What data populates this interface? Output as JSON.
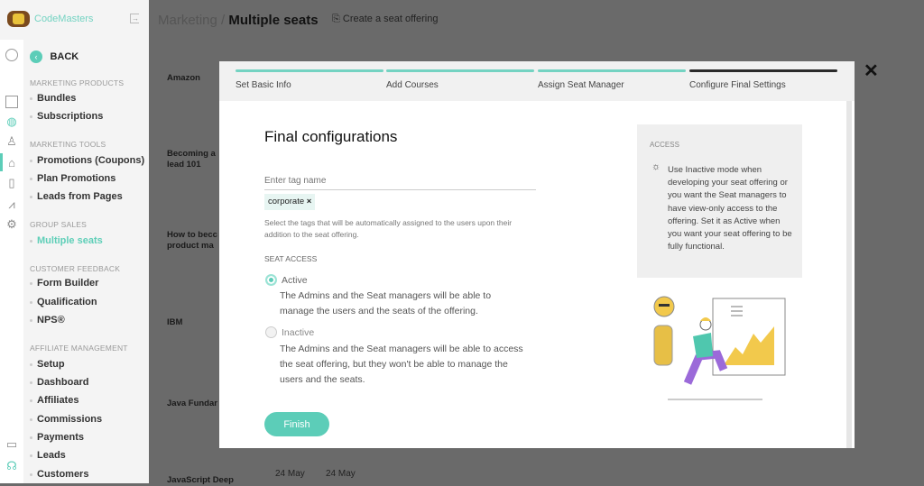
{
  "app": {
    "name": "CodeMasters"
  },
  "header": {
    "breadcrumb_parent": "Marketing",
    "breadcrumb_sep": " / ",
    "title": "Multiple seats",
    "action": "Create a seat offering"
  },
  "sidebar": {
    "back": "BACK",
    "sections": [
      {
        "title": "MARKETING PRODUCTS",
        "items": [
          "Bundles",
          "Subscriptions"
        ]
      },
      {
        "title": "MARKETING TOOLS",
        "items": [
          "Promotions (Coupons)",
          "Plan Promotions",
          "Leads from Pages"
        ]
      },
      {
        "title": "GROUP SALES",
        "items": [
          "Multiple seats"
        ]
      },
      {
        "title": "CUSTOMER FEEDBACK",
        "items": [
          "Form Builder",
          "Qualification",
          "NPS®"
        ]
      },
      {
        "title": "AFFILIATE MANAGEMENT",
        "items": [
          "Setup",
          "Dashboard",
          "Affiliates",
          "Commissions",
          "Payments",
          "Leads",
          "Customers"
        ]
      }
    ],
    "active_item": "Multiple seats"
  },
  "background_list": {
    "rows": [
      "Amazon",
      "Becoming a\nlead 101",
      "How to becc\nproduct ma",
      "IBM",
      "Java Fundar",
      "JavaScript Deep"
    ],
    "dates": [
      "24 May",
      "24 May"
    ]
  },
  "modal": {
    "steps": [
      {
        "label": "Set Basic Info",
        "done": true
      },
      {
        "label": "Add Courses",
        "done": true
      },
      {
        "label": "Assign Seat Manager",
        "done": true
      },
      {
        "label": "Configure Final Settings",
        "current": true
      }
    ],
    "title": "Final configurations",
    "tag_input": {
      "placeholder": "Enter tag name",
      "value": ""
    },
    "tags": [
      "corporate"
    ],
    "tag_help": "Select the tags that will be automatically assigned to the users upon their addition to the seat offering.",
    "seat_access_label": "SEAT ACCESS",
    "options": [
      {
        "label": "Active",
        "selected": true,
        "desc": "The Admins and the Seat managers will be able to manage the users and the seats of the offering."
      },
      {
        "label": "Inactive",
        "selected": false,
        "desc": "The Admins and the Seat managers will be able to access the seat offering, but they won't be able to manage the users and the seats."
      }
    ],
    "finish": "Finish",
    "info": {
      "title": "ACCESS",
      "icon": "lightbulb-icon",
      "text": "Use Inactive mode when developing your seat offering or you want the Seat managers to have view-only access to the offering. Set it as Active when you want your seat offering to be fully functional."
    }
  },
  "colors": {
    "accent": "#5ccdb8",
    "overlay": "#6a6a6a"
  }
}
